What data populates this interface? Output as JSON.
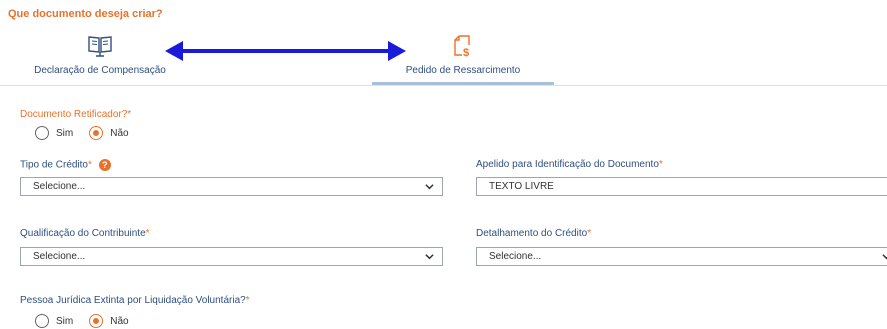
{
  "heading": "Que documento deseja criar?",
  "tabs": [
    {
      "label": "Declaração de Compensação",
      "icon": "book-icon",
      "selected": false
    },
    {
      "label": "Pedido de Ressarcimento",
      "icon": "document-dollar-icon",
      "selected": true
    }
  ],
  "retificador": {
    "label": "Documento Retificador?",
    "required_mark": "*",
    "options": [
      "Sim",
      "Não"
    ],
    "selected": "Não"
  },
  "tipo_credito": {
    "label": "Tipo de Crédito",
    "required_mark": "*",
    "help_glyph": "?",
    "value": "Selecione..."
  },
  "apelido": {
    "label": "Apelido para Identificação do Documento",
    "required_mark": "*",
    "value": "TEXTO LIVRE"
  },
  "qualificacao": {
    "label": "Qualificação do Contribuinte",
    "required_mark": "*",
    "value": "Selecione..."
  },
  "detalhamento": {
    "label": "Detalhamento do Crédito",
    "required_mark": "*",
    "value": "Selecione..."
  },
  "pj_extinta": {
    "label": "Pessoa Jurídica Extinta por Liquidação Voluntária?",
    "required_mark": "*",
    "options": [
      "Sim",
      "Não"
    ],
    "selected": "Não"
  },
  "colors": {
    "accent": "#e8722c",
    "label": "#2f4f7f",
    "arrow": "#1a1adb"
  }
}
